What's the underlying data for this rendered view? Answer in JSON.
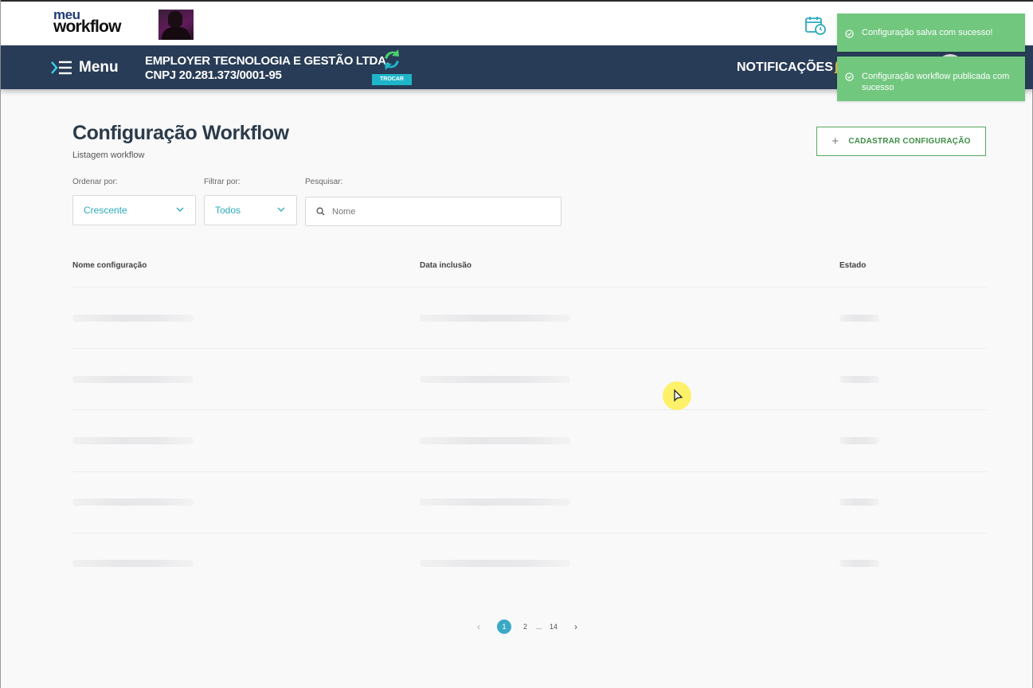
{
  "brand": {
    "logo_top": "meu",
    "logo_bottom": "workflow"
  },
  "nav": {
    "menu_label": "Menu",
    "company_name": "EMPLOYER TECNOLOGIA E GESTÃO LTDA.",
    "company_cnpj": "CNPJ 20.281.373/0001-95",
    "switch_label": "TROCAR",
    "notifications_label": "NOTIFICAÇÕES"
  },
  "toasts": [
    {
      "text": "Configuração salva com sucesso!"
    },
    {
      "text": "Configuração workflow publicada com sucesso"
    }
  ],
  "page": {
    "title": "Configuração Workflow",
    "subtitle": "Listagem workflow",
    "create_button": "CADASTRAR CONFIGURAÇÃO",
    "create_icon": "+"
  },
  "filters": {
    "order_label": "Ordenar por:",
    "order_value": "Crescente",
    "filter_label": "Filtrar por:",
    "filter_value": "Todos",
    "search_label": "Pesquisar:",
    "search_placeholder": "Nome"
  },
  "table": {
    "columns": [
      "Nome configuração",
      "Data inclusão",
      "Estado"
    ],
    "rows_loading": 5
  },
  "pagination": {
    "prev": "‹",
    "current": "1",
    "next_page": "2",
    "ellipsis": "...",
    "last": "14",
    "next": "›"
  },
  "colors": {
    "navbar": "#283c57",
    "accent": "#2aa9bd",
    "toast": "#72c77f",
    "primary_outline": "#58a85f"
  }
}
